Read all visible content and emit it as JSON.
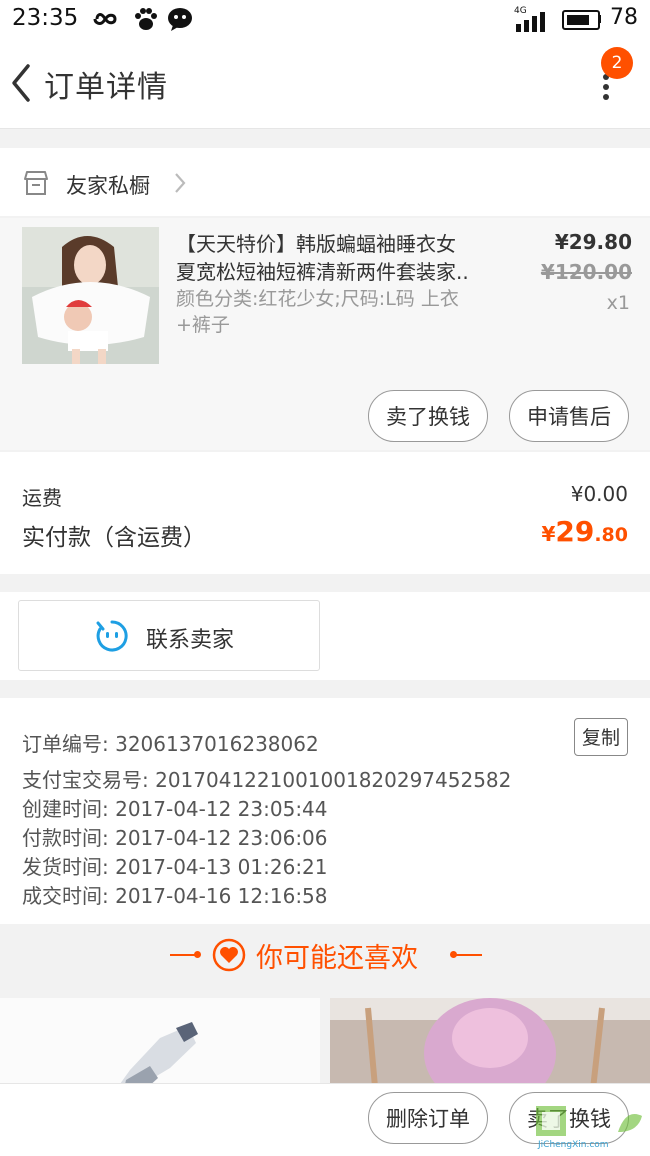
{
  "status_bar": {
    "time": "23:35",
    "network": "4G",
    "battery_level": "78"
  },
  "header": {
    "title": "订单详情",
    "badge_count": "2"
  },
  "store": {
    "name": "友家私橱"
  },
  "product": {
    "title_line1": "【天天特价】韩版蝙蝠袖睡衣女",
    "title_line2": "夏宽松短袖短裤清新两件套装家..",
    "sku": "颜色分类:红花少女;尺码:L码 上衣+裤子",
    "price": "¥29.80",
    "original_price": "¥120.00",
    "quantity": "x1",
    "btn_sell": "卖了换钱",
    "btn_aftersale": "申请售后"
  },
  "fees": {
    "shipping_label": "运费",
    "shipping_value": "¥0.00",
    "paid_label": "实付款（含运费）",
    "paid_currency": "¥",
    "paid_int": "29",
    "paid_dec": ".80"
  },
  "contact": {
    "label": "联系卖家"
  },
  "order_info": {
    "order_no": "订单编号: 3206137016238062",
    "copy_label": "复制",
    "alipay_no": "支付宝交易号: 2017041221001001820297452582",
    "created": "创建时间: 2017-04-12 23:05:44",
    "paid": "付款时间: 2017-04-12 23:06:06",
    "shipped": "发货时间: 2017-04-13 01:26:21",
    "completed": "成交时间: 2017-04-16 12:16:58"
  },
  "recommend": {
    "title": "你可能还喜欢"
  },
  "bottom_bar": {
    "delete_label": "删除订单",
    "sell_label": "卖了换钱"
  },
  "watermark": {
    "text": "JiChengXin.com"
  },
  "colors": {
    "accent": "#ff5000",
    "text": "#333333",
    "muted": "#999999",
    "bg": "#f2f2f2"
  },
  "icons": [
    "infinity-icon",
    "paw-icon",
    "wechat-icon",
    "signal-icon",
    "battery-icon",
    "back-icon",
    "more-icon",
    "shop-icon",
    "chevron-right-icon",
    "chat-face-icon",
    "heart-icon"
  ]
}
